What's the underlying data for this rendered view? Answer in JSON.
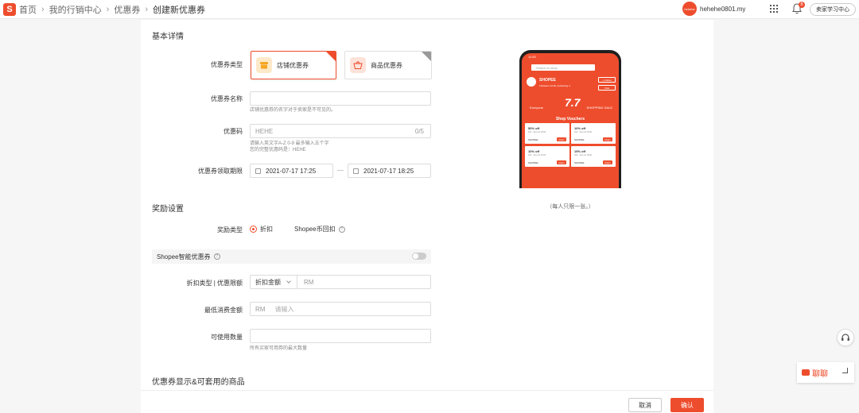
{
  "header": {
    "logo_char": "S",
    "breadcrumbs": [
      "首页",
      "我的行销中心",
      "优惠券",
      "创建新优惠券"
    ],
    "username": "hehehe0801.my",
    "avatar_text": "hehehe",
    "notification_count": "8",
    "learn_button": "卖家学习中心"
  },
  "basic": {
    "section_title": "基本详情",
    "voucher_type_label": "优惠券类型",
    "type_options": [
      {
        "label": "店铺优惠券",
        "selected": true
      },
      {
        "label": "商品优惠券",
        "selected": false
      }
    ],
    "name_label": "优惠券名称",
    "name_value": "",
    "name_hint": "店铺优惠券的名字对于卖家是不可见的。",
    "code_label": "优惠码",
    "code_prefix": "HEHE",
    "code_counter": "0/5",
    "code_hint_1": "请输入英文字A-Z 0-9 最多输入五个字",
    "code_hint_2": "您的完整优惠码是：HEHE",
    "period_label": "优惠券领取期限",
    "start_date": "2021-07-17 17:25",
    "end_date": "2021-07-17 18:25",
    "date_separator": "—"
  },
  "reward": {
    "section_title": "奖励设置",
    "reward_type_label": "奖励类型",
    "options": [
      {
        "label": "折扣",
        "selected": true
      },
      {
        "label": "Shopee币回扣",
        "selected": false
      }
    ],
    "smart_label": "Shopee智能优惠券",
    "smart_enabled": false,
    "discount_label": "折扣类型 | 优惠限额",
    "discount_select": "折扣金额",
    "discount_currency": "RM",
    "min_spend_label": "最低消费金额",
    "min_spend_currency": "RM",
    "min_spend_placeholder": "请输入",
    "qty_label": "可使用数量",
    "qty_value": "",
    "qty_hint": "所有买家可用券的最大数量"
  },
  "display": {
    "section_title": "优惠券显示&可套用的商品"
  },
  "preview": {
    "status_time": "11:00",
    "search_placeholder": "Search in shop",
    "shop_name": "SHOPEE",
    "shop_meta": "Followers 10.6k | Following 4",
    "follow_btn": "+ Follow",
    "chat_btn": "Chat",
    "banner_big": "7.7",
    "banner_left": "Everyone",
    "banner_right": "SHOPPING SALE",
    "vouchers_title": "Shop Vouchers",
    "vouchers": [
      {
        "title": "50% off",
        "sub": "Min. Spend RM0",
        "brand": "SHOPEE",
        "claim": "Claim"
      },
      {
        "title": "10% off",
        "sub": "Min. Spend RM0",
        "brand": "SHOPEE",
        "claim": "Claim"
      },
      {
        "title": "10% off",
        "sub": "Min. Spend RM0",
        "brand": "SHOPEE",
        "claim": "Claim"
      },
      {
        "title": "15% off",
        "sub": "Min. Spend RM0",
        "brand": "SHOPEE",
        "claim": "Claim"
      }
    ],
    "caption": "（每人只限一张。）"
  },
  "footer": {
    "cancel": "取消",
    "confirm": "确认"
  },
  "floating": {
    "chat_label": "聊聊"
  },
  "colors": {
    "accent": "#ee4d2d"
  }
}
